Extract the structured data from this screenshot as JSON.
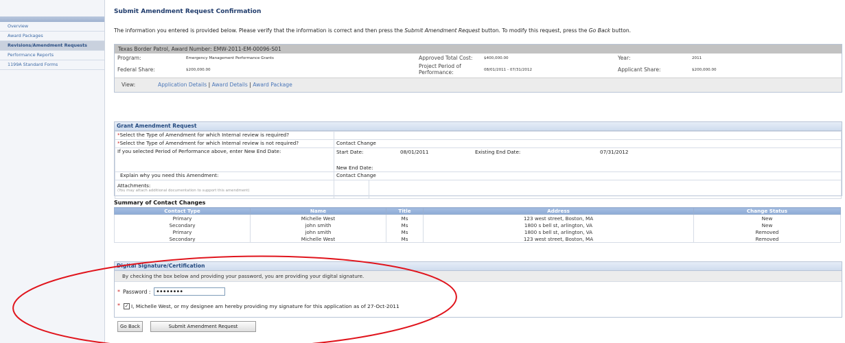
{
  "sidebar": {
    "items": [
      {
        "label": "Overview",
        "active": false
      },
      {
        "label": "Award Packages",
        "active": false
      },
      {
        "label": "Revisions/Amendment Requests",
        "active": true
      },
      {
        "label": "Performance Reports",
        "active": false
      },
      {
        "label": "1199A Standard Forms",
        "active": false
      }
    ]
  },
  "page": {
    "title": "Submit Amendment Request Confirmation",
    "intro_1": "The information you entered is provided below. Please verify that the information is correct and then press the ",
    "intro_submit": "Submit Amendment Request",
    "intro_2": " button. To modify this request, press the ",
    "intro_goback": "Go Back",
    "intro_3": " button."
  },
  "award": {
    "header": "Texas Border Patrol, Award Number: EMW-2011-EM-00096-S01",
    "program_label": "Program:",
    "program_value": "Emergency Management Performance Grants",
    "approved_label": "Approved Total Cost:",
    "approved_value": "$400,000.00",
    "year_label": "Year:",
    "year_value": "2011",
    "federal_label": "Federal Share:",
    "federal_value": "$200,000.00",
    "period_label_1": "Project Period of",
    "period_label_2": "Performance:",
    "period_value": "08/01/2011 - 07/31/2012",
    "applicant_label": "Applicant Share:",
    "applicant_value": "$200,000.00",
    "view_label": "View:",
    "view_links": [
      "Application Details",
      "Award Details",
      "Award Package"
    ],
    "sep": "|"
  },
  "grant": {
    "header": "Grant Amendment Request",
    "row1_label": "Select the Type of Amendment for which Internal review is required?",
    "row1_value": "",
    "row2_label": "Select the Type of Amendment for which Internal review is not required?",
    "row2_value": "Contact Change",
    "row3_label": "If you selected Period of Performance above, enter New End Date:",
    "start_label": "Start Date:",
    "start_value": "08/01/2011",
    "existing_label": "Existing End Date:",
    "existing_value": "07/31/2012",
    "new_end_label": "New End Date:",
    "explain_label": "Explain why you need this Amendment:",
    "explain_value": "Contact Change",
    "attach_label": "Attachments:",
    "attach_note": "(You may attach additional documentation to support this amendment)"
  },
  "summary": {
    "title": "Summary of Contact Changes",
    "columns": [
      "Contact Type",
      "Name",
      "Title",
      "Address",
      "Change Status"
    ],
    "rows": [
      [
        "Primary",
        "Michelle West",
        "Ms",
        "123 west street, Boston, MA",
        "New"
      ],
      [
        "Secondary",
        "john smith",
        "Ms",
        "1800 s bell st, arlington, VA",
        "New"
      ],
      [
        "Primary",
        "john smith",
        "Ms",
        "1800 s bell st, arlington, VA",
        "Removed"
      ],
      [
        "Secondary",
        "Michelle West",
        "Ms",
        "123 west street, Boston, MA",
        "Removed"
      ]
    ]
  },
  "signature": {
    "header": "Digital Signature/Certification",
    "instruction": "By checking the box below and providing your password, you are providing your digital signature.",
    "password_label": "Password :",
    "password_value": "••••••••",
    "checkbox_checked": true,
    "statement": "I, Michelle West, or my designee am hereby providing my signature for this application as of 27-Oct-2011"
  },
  "buttons": {
    "go_back": "Go Back",
    "submit": "Submit Amendment Request"
  },
  "annotation": {
    "color": "#e0141c"
  }
}
